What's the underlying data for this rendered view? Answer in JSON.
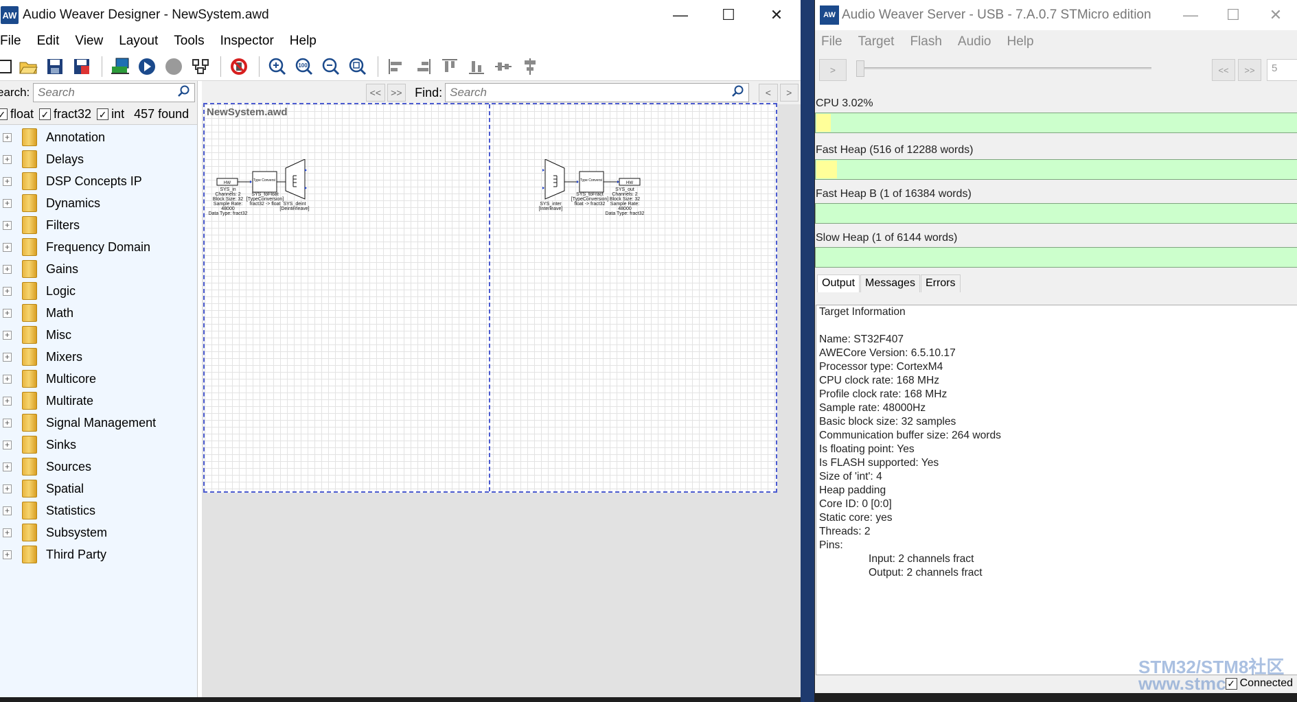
{
  "designer": {
    "title": "Audio Weaver Designer - NewSystem.awd",
    "logo": "AW",
    "menu": [
      "File",
      "Edit",
      "View",
      "Layout",
      "Tools",
      "Inspector",
      "Help"
    ],
    "toolbar_icons": [
      "new-file-icon",
      "open-folder-icon",
      "save-icon",
      "save-all-icon",
      "build-icon",
      "run-icon",
      "stop-icon",
      "network-icon",
      "no-profile-icon",
      "zoom-in-icon",
      "zoom-100-icon",
      "zoom-out-icon",
      "zoom-fit-icon",
      "align-left-icon",
      "align-right-icon",
      "align-top-icon",
      "align-bottom-icon",
      "distribute-h-icon",
      "distribute-v-icon"
    ],
    "zoom_100_label": "100",
    "search": {
      "label": "earch:",
      "placeholder": "Search"
    },
    "filters": [
      {
        "label": "float",
        "checked": true
      },
      {
        "label": "fract32",
        "checked": true
      },
      {
        "label": "int",
        "checked": true
      }
    ],
    "found": "457 found",
    "tree": [
      "Annotation",
      "Delays",
      "DSP Concepts IP",
      "Dynamics",
      "Filters",
      "Frequency Domain",
      "Gains",
      "Logic",
      "Math",
      "Misc",
      "Mixers",
      "Multicore",
      "Multirate",
      "Signal Management",
      "Sinks",
      "Sources",
      "Spatial",
      "Statistics",
      "Subsystem",
      "Third Party"
    ],
    "canvas": {
      "nav_prev": "<<",
      "nav_next": ">>",
      "find_label": "Find:",
      "find_placeholder": "Search",
      "scroll_left": "<",
      "scroll_right": ">",
      "document": "NewSystem.awd",
      "blocks": {
        "hw_in": "HW",
        "hw_in_caption": [
          "SYS_in",
          "Channels: 2",
          "Block Size: 32",
          "Sample Rate: 48000",
          "Data Type: fract32"
        ],
        "type_conv1": "Type Conversi",
        "type_conv1_caption": [
          "SYS_toFloat",
          "[TypeConversion]",
          "fract32 -> float"
        ],
        "deint_caption": [
          "SYS_deint",
          "[Deinterleave]"
        ],
        "inter_caption": [
          "SYS_inter",
          "[Interleave]"
        ],
        "type_conv2": "Type Conversi",
        "type_conv2_caption": [
          "SYS_toFract",
          "[TypeConversion]",
          "float -> fract32"
        ],
        "hw_out": "HW",
        "hw_out_caption": [
          "SYS_out",
          "Channels: 2",
          "Block Size: 32",
          "Sample Rate: 48000",
          "Data Type: fract32"
        ]
      }
    },
    "controls": {
      "minimize": "—",
      "maximize": "☐",
      "close": "✕"
    }
  },
  "server": {
    "title": "Audio Weaver Server - USB - 7.A.0.7 STMicro edition",
    "logo": "AW",
    "menu": [
      "File",
      "Target",
      "Flash",
      "Audio",
      "Help"
    ],
    "play": ">",
    "nav_prev": "<<",
    "nav_next": ">>",
    "slider_value": 0,
    "number": "5",
    "meters": [
      {
        "label": "CPU 3.02%",
        "fraction": 0.0302
      },
      {
        "label": "Fast Heap (516 of 12288 words)",
        "fraction": 0.042
      },
      {
        "label": "Fast Heap B (1 of 16384 words)",
        "fraction": 0.0001
      },
      {
        "label": "Slow Heap (1 of 6144 words)",
        "fraction": 0.0002
      }
    ],
    "tabs": [
      "Output",
      "Messages",
      "Errors"
    ],
    "output_lines": [
      "Target Information",
      "",
      "Name: ST32F407",
      "AWECore Version: 6.5.10.17",
      "Processor type: CortexM4",
      "CPU clock rate: 168 MHz",
      "Profile clock rate: 168 MHz",
      "Sample rate: 48000Hz",
      "Basic block size: 32 samples",
      "Communication buffer size: 264 words",
      "Is floating point: Yes",
      "Is FLASH supported: Yes",
      "Size of 'int': 4",
      "Heap padding",
      "Core ID: 0 [0:0]",
      "Static core: yes",
      "Threads: 2",
      "Pins:"
    ],
    "pin_lines": [
      "Input: 2 channels fract",
      "Output: 2 channels fract"
    ],
    "connected": "Connected",
    "colors": {
      "meter_bg": "#ccffcc",
      "meter_fill": "#ffff99"
    }
  },
  "watermark": {
    "line1": "STM32/STM8社区",
    "line2": "www.stmc"
  }
}
